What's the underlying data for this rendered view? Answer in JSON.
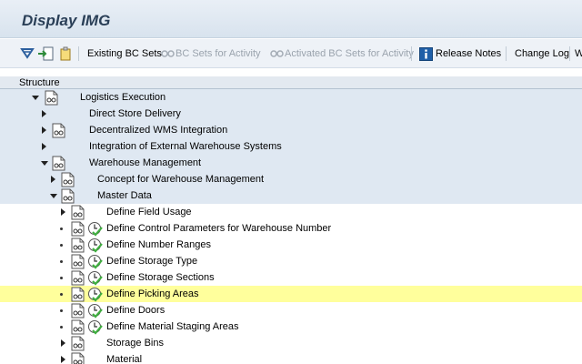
{
  "window": {
    "title": "Display IMG"
  },
  "toolbar": {
    "existing_bc_sets": "Existing BC Sets",
    "bc_sets_for_activity": "BC Sets for Activity",
    "activated_bc_sets": "Activated BC Sets for Activity",
    "release_notes": "Release Notes",
    "change_log": "Change Log",
    "overflow": "W"
  },
  "structure": {
    "header": "Structure",
    "nodes": [
      {
        "label": "Logistics Execution"
      },
      {
        "label": "Direct Store Delivery"
      },
      {
        "label": "Decentralized WMS Integration"
      },
      {
        "label": "Integration of External Warehouse Systems"
      },
      {
        "label": "Warehouse Management"
      },
      {
        "label": "Concept for Warehouse Management"
      },
      {
        "label": "Master Data"
      },
      {
        "label": "Define Field Usage"
      },
      {
        "label": "Define Control Parameters for Warehouse Number"
      },
      {
        "label": "Define Number Ranges"
      },
      {
        "label": "Define Storage Type"
      },
      {
        "label": "Define Storage Sections"
      },
      {
        "label": "Define Picking Areas"
      },
      {
        "label": "Define Doors"
      },
      {
        "label": "Define Material Staging Areas"
      },
      {
        "label": "Storage Bins"
      },
      {
        "label": "Material"
      }
    ]
  },
  "colors": {
    "highlight": "#ffff9c",
    "shade": "#dfe8f2",
    "check": "#3fae3f"
  }
}
